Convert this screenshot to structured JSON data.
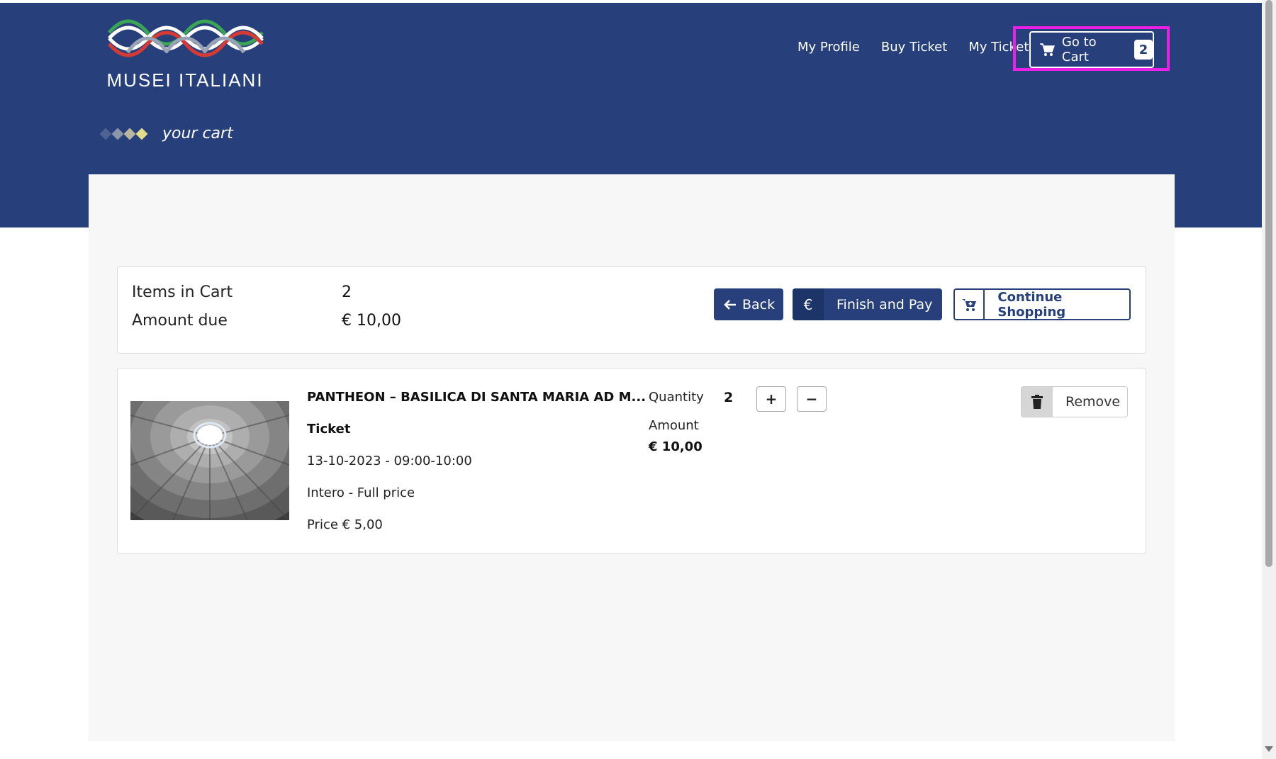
{
  "brand": {
    "name": "MUSEI ITALIANI"
  },
  "nav": {
    "links": [
      "My  Profile",
      "Buy Ticket",
      "My Ticket"
    ],
    "cart_label": "Go to Cart",
    "cart_count": "2"
  },
  "breadcrumb": {
    "text": "your cart"
  },
  "summary": {
    "items_label": "Items in Cart",
    "items_value": "2",
    "amount_label": "Amount due",
    "amount_value": "€ 10,00"
  },
  "actions": {
    "back": "Back",
    "pay_icon": "€",
    "pay": "Finish and  Pay",
    "continue": "Continue Shopping"
  },
  "item": {
    "title": "PANTHEON – BASILICA  DI SANTA  MARIA AD  M...",
    "type": "Ticket",
    "date": "13-10-2023 - 09:00-10:00",
    "fare": "Intero -  Full price",
    "price": "Price € 5,00",
    "quantity_label": "Quantity",
    "quantity": "2",
    "plus": "+",
    "minus": "−",
    "amount_label": "Amount",
    "amount": "€ 10,00",
    "remove": "Remove"
  },
  "colors": {
    "primary": "#27407b",
    "highlight": "#ec1fe6",
    "panel": "#f7f7f7"
  },
  "icons": [
    "logo-waves-icon",
    "cart-icon",
    "arrow-left-icon",
    "euro-icon",
    "cart-plus-icon",
    "trash-icon"
  ]
}
